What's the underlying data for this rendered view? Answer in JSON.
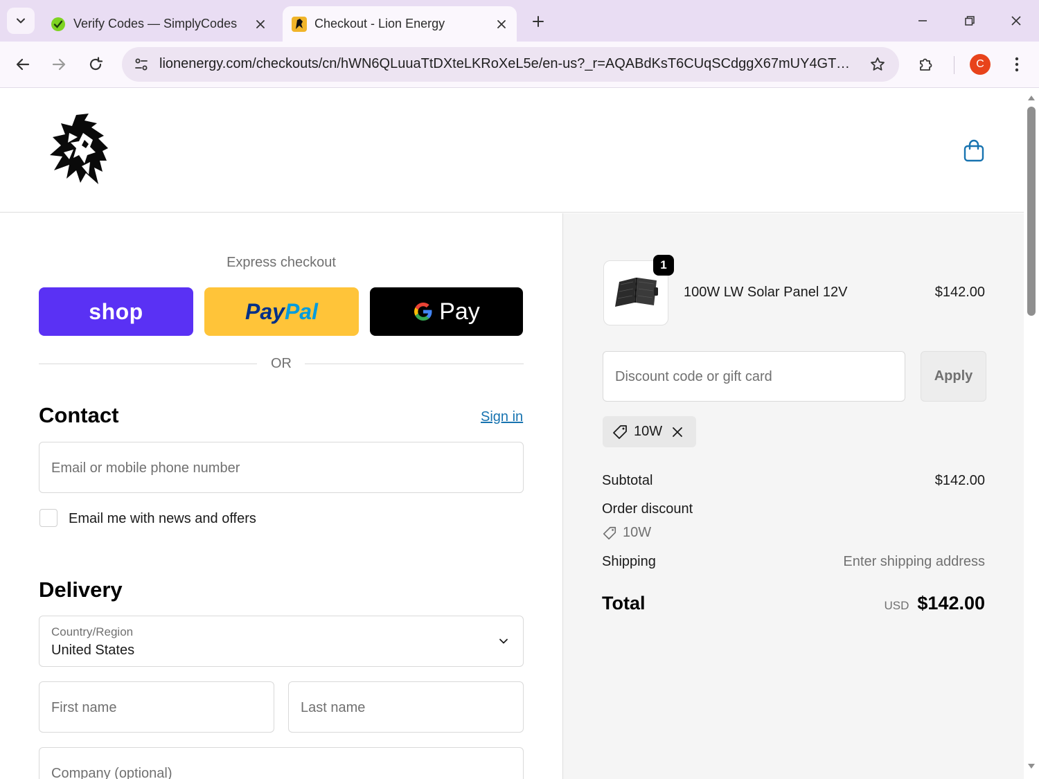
{
  "browser": {
    "tabs": [
      {
        "title": "Verify Codes — SimplyCodes",
        "favicon": "simplycodes-icon",
        "active": false
      },
      {
        "title": "Checkout - Lion Energy",
        "favicon": "lion-energy-icon",
        "active": true
      }
    ],
    "url": "lionenergy.com/checkouts/cn/hWN6QLuuaTtDXteLKRoXeL5e/en-us?_r=AQABdKsT6CUqSCdggX67mUY4GTO...",
    "profile_initial": "C"
  },
  "express": {
    "title": "Express checkout",
    "shop_label": "shop",
    "paypal_label_1": "Pay",
    "paypal_label_2": "Pal",
    "gpay_label": "Pay",
    "or_label": "OR"
  },
  "contact": {
    "title": "Contact",
    "sign_in": "Sign in",
    "email_placeholder": "Email or mobile phone number",
    "newsletter_label": "Email me with news and offers"
  },
  "delivery": {
    "title": "Delivery",
    "country_label": "Country/Region",
    "country_value": "United States",
    "first_name_placeholder": "First name",
    "last_name_placeholder": "Last name",
    "company_placeholder": "Company (optional)"
  },
  "summary": {
    "item": {
      "name": "100W LW Solar Panel 12V",
      "price": "$142.00",
      "quantity": "1"
    },
    "discount_placeholder": "Discount code or gift card",
    "apply_label": "Apply",
    "applied_code": "10W",
    "subtotal_label": "Subtotal",
    "subtotal_value": "$142.00",
    "order_discount_label": "Order discount",
    "order_discount_code": "10W",
    "shipping_label": "Shipping",
    "shipping_value": "Enter shipping address",
    "total_label": "Total",
    "total_currency": "USD",
    "total_value": "$142.00"
  },
  "colors": {
    "shop_pay": "#5a31f4",
    "paypal": "#ffc439",
    "link": "#1773b0",
    "tab_strip": "#e9ddf3"
  }
}
